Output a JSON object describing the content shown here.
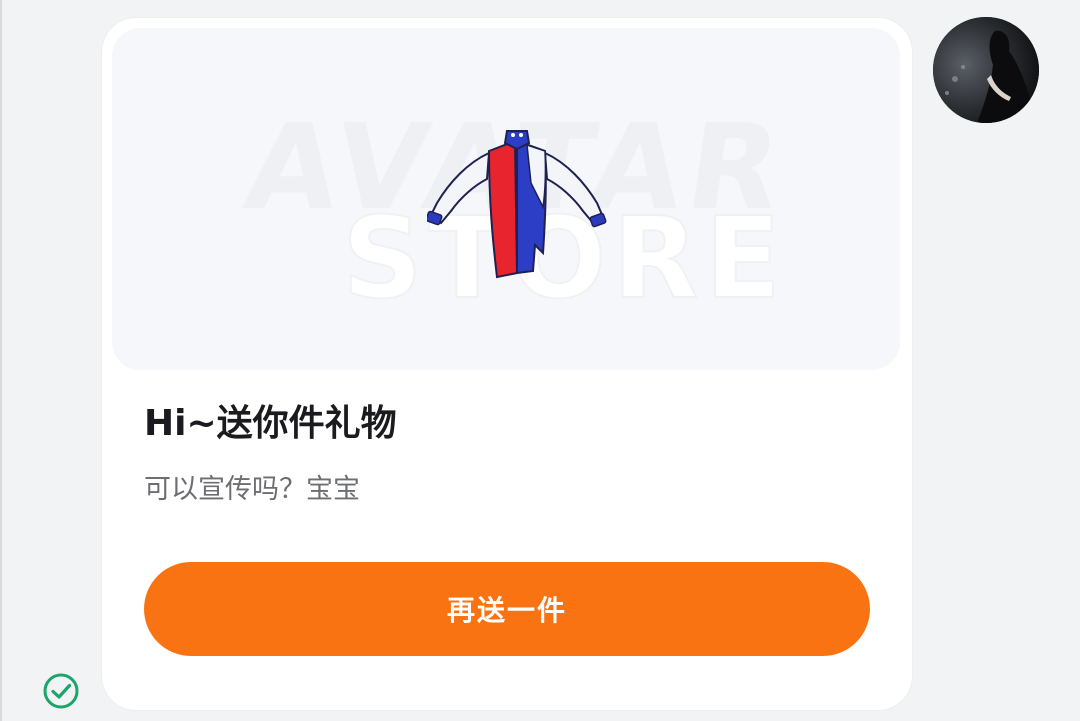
{
  "message_card": {
    "title": "Hi~送你件礼物",
    "subtitle": "可以宣传吗？宝宝",
    "button_label": "再送一件",
    "accent_color": "#fa7313",
    "gift_image": {
      "watermark_line1": "AVATAR",
      "watermark_line2": "STORE",
      "item_icon": "jacket-icon"
    }
  },
  "sender": {
    "avatar_icon": "user-avatar"
  },
  "status": {
    "icon": "check-circle-icon",
    "color": "#1aa56b"
  }
}
